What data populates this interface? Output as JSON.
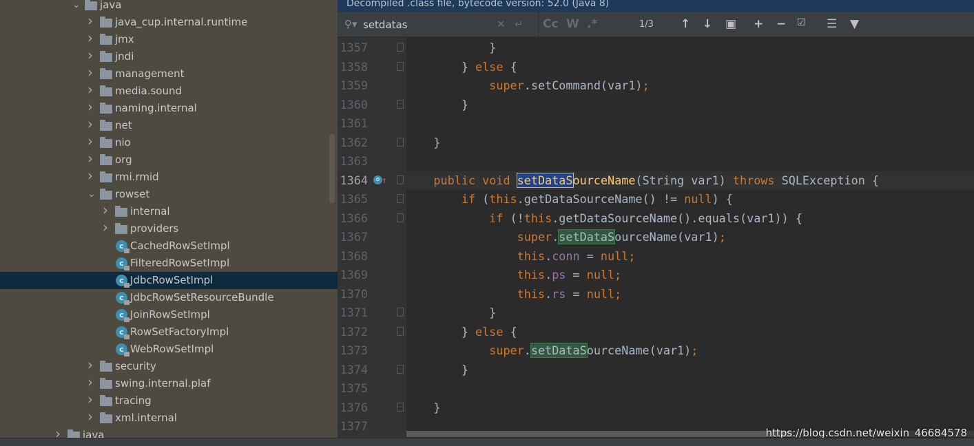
{
  "banner": "Decompiled .class file, bytecode version: 52.0 (Java 8)",
  "search": {
    "value": "setdatas",
    "match_count": "1/3",
    "case_label": "Cc",
    "word_label": "W",
    "regex_label": ".*"
  },
  "tree": [
    {
      "label": "java",
      "type": "folder",
      "level": 0,
      "expanded": true
    },
    {
      "label": "java_cup.internal.runtime",
      "type": "folder",
      "level": 1
    },
    {
      "label": "jmx",
      "type": "folder",
      "level": 1
    },
    {
      "label": "jndi",
      "type": "folder",
      "level": 1
    },
    {
      "label": "management",
      "type": "folder",
      "level": 1
    },
    {
      "label": "media.sound",
      "type": "folder",
      "level": 1
    },
    {
      "label": "naming.internal",
      "type": "folder",
      "level": 1
    },
    {
      "label": "net",
      "type": "folder",
      "level": 1
    },
    {
      "label": "nio",
      "type": "folder",
      "level": 1
    },
    {
      "label": "org",
      "type": "folder",
      "level": 1
    },
    {
      "label": "rmi.rmid",
      "type": "folder",
      "level": 1
    },
    {
      "label": "rowset",
      "type": "folder",
      "level": 1,
      "expanded": true
    },
    {
      "label": "internal",
      "type": "folder",
      "level": 2
    },
    {
      "label": "providers",
      "type": "folder",
      "level": 2
    },
    {
      "label": "CachedRowSetImpl",
      "type": "class",
      "level": 2
    },
    {
      "label": "FilteredRowSetImpl",
      "type": "class",
      "level": 2
    },
    {
      "label": "JdbcRowSetImpl",
      "type": "class",
      "level": 2,
      "selected": true
    },
    {
      "label": "JdbcRowSetResourceBundle",
      "type": "class",
      "level": 2
    },
    {
      "label": "JoinRowSetImpl",
      "type": "class",
      "level": 2
    },
    {
      "label": "RowSetFactoryImpl",
      "type": "class",
      "level": 2
    },
    {
      "label": "WebRowSetImpl",
      "type": "class",
      "level": 2
    },
    {
      "label": "security",
      "type": "folder",
      "level": 1
    },
    {
      "label": "swing.internal.plaf",
      "type": "folder",
      "level": 1
    },
    {
      "label": "tracing",
      "type": "folder",
      "level": 1
    },
    {
      "label": "xml.internal",
      "type": "folder",
      "level": 1
    },
    {
      "label": "java",
      "type": "folder",
      "level": -1
    }
  ],
  "code": [
    {
      "n": "1357",
      "i": 3,
      "fold": true,
      "t": [
        [
          "pl",
          "}"
        ]
      ]
    },
    {
      "n": "1358",
      "i": 2,
      "fold": true,
      "t": [
        [
          "pl",
          "} "
        ],
        [
          "kw",
          "else"
        ],
        [
          "pl",
          " {"
        ]
      ]
    },
    {
      "n": "1359",
      "i": 3,
      "t": [
        [
          "kw",
          "super"
        ],
        [
          "pl",
          ".setCommand(var1)"
        ],
        [
          "kw",
          ";"
        ]
      ]
    },
    {
      "n": "1360",
      "i": 2,
      "fold": true,
      "t": [
        [
          "pl",
          "}"
        ]
      ]
    },
    {
      "n": "1361",
      "i": 0,
      "t": []
    },
    {
      "n": "1362",
      "i": 1,
      "fold": true,
      "t": [
        [
          "pl",
          "}"
        ]
      ]
    },
    {
      "n": "1363",
      "i": 0,
      "t": []
    },
    {
      "n": "1364",
      "i": 1,
      "fold": true,
      "cur": true,
      "t": [
        [
          "kw",
          "public void "
        ],
        [
          "fn hl1",
          "setDataS"
        ],
        [
          "fn",
          "ourceName"
        ],
        [
          "pl",
          "(String var1) "
        ],
        [
          "kw",
          "throws "
        ],
        [
          "pl",
          "SQLException {"
        ]
      ]
    },
    {
      "n": "1365",
      "i": 2,
      "fold": true,
      "t": [
        [
          "kw",
          "if "
        ],
        [
          "pl",
          "("
        ],
        [
          "kw",
          "this"
        ],
        [
          "pl",
          ".getDataSourceName() != "
        ],
        [
          "kw",
          "null"
        ],
        [
          "pl",
          ") {"
        ]
      ]
    },
    {
      "n": "1366",
      "i": 3,
      "fold": true,
      "t": [
        [
          "kw",
          "if "
        ],
        [
          "pl",
          "(!"
        ],
        [
          "kw",
          "this"
        ],
        [
          "pl",
          ".getDataSourceName().equals(var1)) {"
        ]
      ]
    },
    {
      "n": "1367",
      "i": 4,
      "t": [
        [
          "kw",
          "super"
        ],
        [
          "pl",
          "."
        ],
        [
          "pl hl2",
          "setDataS"
        ],
        [
          "pl",
          "ourceName(var1)"
        ],
        [
          "kw",
          ";"
        ]
      ]
    },
    {
      "n": "1368",
      "i": 4,
      "t": [
        [
          "kw",
          "this"
        ],
        [
          "pl",
          "."
        ],
        [
          "fd",
          "conn"
        ],
        [
          "pl",
          " = "
        ],
        [
          "kw",
          "null;"
        ]
      ]
    },
    {
      "n": "1369",
      "i": 4,
      "t": [
        [
          "kw",
          "this"
        ],
        [
          "pl",
          "."
        ],
        [
          "fd",
          "ps"
        ],
        [
          "pl",
          " = "
        ],
        [
          "kw",
          "null;"
        ]
      ]
    },
    {
      "n": "1370",
      "i": 4,
      "t": [
        [
          "kw",
          "this"
        ],
        [
          "pl",
          "."
        ],
        [
          "fd",
          "rs"
        ],
        [
          "pl",
          " = "
        ],
        [
          "kw",
          "null;"
        ]
      ]
    },
    {
      "n": "1371",
      "i": 3,
      "fold": true,
      "t": [
        [
          "pl",
          "}"
        ]
      ]
    },
    {
      "n": "1372",
      "i": 2,
      "fold": true,
      "t": [
        [
          "pl",
          "} "
        ],
        [
          "kw",
          "else"
        ],
        [
          "pl",
          " {"
        ]
      ]
    },
    {
      "n": "1373",
      "i": 3,
      "t": [
        [
          "kw",
          "super"
        ],
        [
          "pl",
          "."
        ],
        [
          "pl hl2",
          "setDataS"
        ],
        [
          "pl",
          "ourceName(var1)"
        ],
        [
          "kw",
          ";"
        ]
      ]
    },
    {
      "n": "1374",
      "i": 2,
      "fold": true,
      "t": [
        [
          "pl",
          "}"
        ]
      ]
    },
    {
      "n": "1375",
      "i": 0,
      "t": []
    },
    {
      "n": "1376",
      "i": 1,
      "fold": true,
      "t": [
        [
          "pl",
          "}"
        ]
      ]
    },
    {
      "n": "1377",
      "i": 0,
      "t": []
    }
  ],
  "watermark": "https://blog.csdn.net/weixin_46684578",
  "colors": {
    "keyword": "#cc7832",
    "field": "#9876aa",
    "function": "#ffc66d",
    "text": "#a9b7c6",
    "search_current": "#214283",
    "search_other": "#32593d",
    "tree_bg": "#4e4a3f",
    "tree_selected": "#0d293e"
  }
}
